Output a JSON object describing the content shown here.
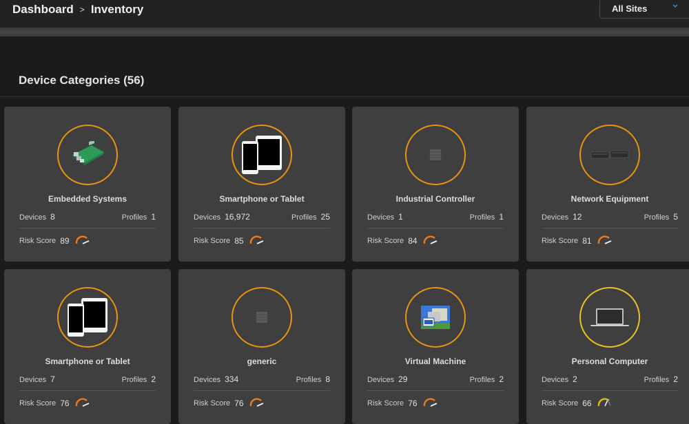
{
  "header": {
    "breadcrumb": [
      "Dashboard",
      "Inventory"
    ],
    "breadcrumb_separator": ">",
    "site_selector": {
      "value": "All Sites",
      "icon": "chevron-down-icon"
    }
  },
  "section": {
    "title": "Device Categories (56)"
  },
  "labels": {
    "devices": "Devices",
    "profiles": "Profiles",
    "risk_score": "Risk Score"
  },
  "colors": {
    "ring_orange": "#e8940f",
    "ring_yellow": "#e6c520",
    "gauge_orange": "#f07a1a",
    "gauge_yellow": "#e6b820",
    "chevron": "#1e90d6"
  },
  "cards": [
    {
      "name": "Embedded Systems",
      "icon": "embedded-board-icon",
      "devices": "8",
      "profiles": "1",
      "risk_score": "89",
      "risk_level": "high"
    },
    {
      "name": "Smartphone or Tablet",
      "icon": "smartphone-tablet-icon",
      "devices": "16,972",
      "profiles": "25",
      "risk_score": "85",
      "risk_level": "high"
    },
    {
      "name": "Industrial Controller",
      "icon": "generic-chip-icon",
      "devices": "1",
      "profiles": "1",
      "risk_score": "84",
      "risk_level": "high"
    },
    {
      "name": "Network Equipment",
      "icon": "network-switch-icon",
      "devices": "12",
      "profiles": "5",
      "risk_score": "81",
      "risk_level": "high"
    },
    {
      "name": "Smartphone or Tablet",
      "icon": "smartphone-tablet-icon",
      "devices": "7",
      "profiles": "2",
      "risk_score": "76",
      "risk_level": "high"
    },
    {
      "name": "generic",
      "icon": "generic-chip-icon",
      "devices": "334",
      "profiles": "8",
      "risk_score": "76",
      "risk_level": "high"
    },
    {
      "name": "Virtual Machine",
      "icon": "virtual-machine-icon",
      "devices": "29",
      "profiles": "2",
      "risk_score": "76",
      "risk_level": "high"
    },
    {
      "name": "Personal Computer",
      "icon": "laptop-icon",
      "devices": "2",
      "profiles": "2",
      "risk_score": "66",
      "risk_level": "medium"
    }
  ]
}
